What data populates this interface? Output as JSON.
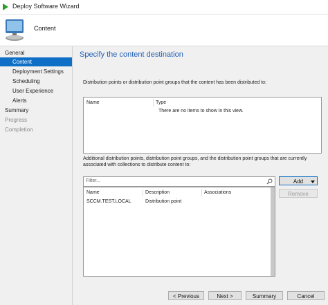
{
  "window": {
    "title": "Deploy Software Wizard"
  },
  "header": {
    "title": "Content"
  },
  "sidebar": {
    "items": [
      {
        "label": "General",
        "level": 0,
        "state": "normal"
      },
      {
        "label": "Content",
        "level": 1,
        "state": "active"
      },
      {
        "label": "Deployment Settings",
        "level": 1,
        "state": "normal"
      },
      {
        "label": "Scheduling",
        "level": 1,
        "state": "normal"
      },
      {
        "label": "User Experience",
        "level": 1,
        "state": "normal"
      },
      {
        "label": "Alerts",
        "level": 1,
        "state": "normal"
      },
      {
        "label": "Summary",
        "level": 0,
        "state": "normal"
      },
      {
        "label": "Progress",
        "level": 0,
        "state": "disabled"
      },
      {
        "label": "Completion",
        "level": 0,
        "state": "disabled"
      }
    ]
  },
  "main": {
    "heading": "Specify the content destination",
    "distributed_text": "Distribution points or distribution point groups that the content has been distributed to:",
    "distributed_list": {
      "columns": [
        "Name",
        "Type"
      ],
      "empty_message": "There are no items to show in this view."
    },
    "additional_text_line1": "Additional distribution points, distribution point groups, and the distribution point groups that are currently",
    "additional_text_line2": "associated with collections to distribute content to:",
    "filter": {
      "placeholder": "Filter..."
    },
    "additional_list": {
      "columns": [
        "Name",
        "Description",
        "Associations"
      ],
      "rows": [
        {
          "name": "SCCM.TEST.LOCAL",
          "description": "Distribution point",
          "associations": ""
        }
      ]
    },
    "add_button": "Add",
    "remove_button": "Remove"
  },
  "footer": {
    "previous": "< Previous",
    "next": "Next >",
    "summary": "Summary",
    "cancel": "Cancel"
  }
}
